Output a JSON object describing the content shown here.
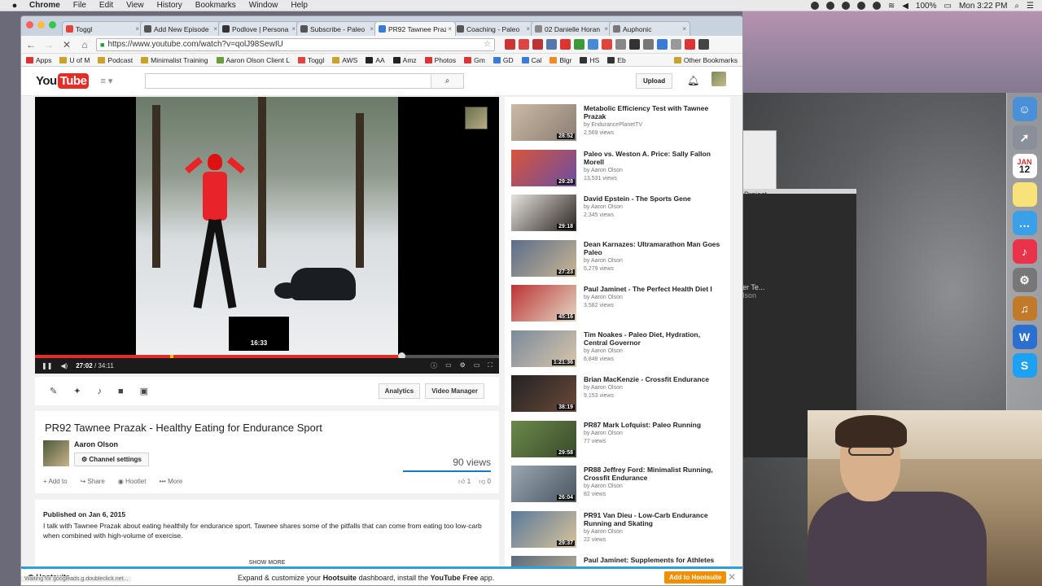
{
  "menubar": {
    "app": "Chrome",
    "items": [
      "File",
      "Edit",
      "View",
      "History",
      "Bookmarks",
      "Window",
      "Help"
    ],
    "battery": "100%",
    "clock": "Mon 3:22 PM"
  },
  "browser": {
    "tabs": [
      {
        "label": "Toggl",
        "color": "#e0443c"
      },
      {
        "label": "Add New Episode",
        "color": "#555"
      },
      {
        "label": "Podlove | Persona",
        "color": "#333"
      },
      {
        "label": "Subscribe - Paleo",
        "color": "#555"
      },
      {
        "label": "PR92 Tawnee Praz",
        "color": "#3a7bd5"
      },
      {
        "label": "Coaching - Paleo",
        "color": "#555"
      },
      {
        "label": "02 Danielle Horan",
        "color": "#888"
      },
      {
        "label": "Auphonic",
        "color": "#777"
      }
    ],
    "url": "https://www.youtube.com/watch?v=qolJ98SewIU",
    "bookmarks": [
      {
        "label": "Apps",
        "color": "#d33"
      },
      {
        "label": "U of M",
        "color": "#c9a227"
      },
      {
        "label": "Podcast",
        "color": "#c9a227"
      },
      {
        "label": "Minimalist Training",
        "color": "#c9a227"
      },
      {
        "label": "Aaron Olson Client L",
        "color": "#6a9e3a"
      },
      {
        "label": "Toggl",
        "color": "#e0443c"
      },
      {
        "label": "AWS",
        "color": "#c9a227"
      },
      {
        "label": "AA",
        "color": "#222"
      },
      {
        "label": "Amz",
        "color": "#222"
      },
      {
        "label": "Photos",
        "color": "#d33"
      },
      {
        "label": "Gm",
        "color": "#d33"
      },
      {
        "label": "GD",
        "color": "#3a7bd5"
      },
      {
        "label": "Cal",
        "color": "#3a7bd5"
      },
      {
        "label": "Blgr",
        "color": "#f08a24"
      },
      {
        "label": "HS",
        "color": "#333"
      },
      {
        "label": "Eb",
        "color": "#333"
      },
      {
        "label": "Other Bookmarks",
        "color": "#c9a227"
      }
    ]
  },
  "youtube": {
    "logo_you": "You",
    "logo_tube": "Tube",
    "upload": "Upload",
    "player": {
      "current_time": "27:02",
      "duration": "/ 34:11",
      "hover_time": "16:33",
      "played_fraction": 0.79
    },
    "edit_buttons": [
      "Analytics",
      "Video Manager"
    ],
    "video": {
      "title": "PR92 Tawnee Prazak - Healthy Eating for Endurance Sport",
      "owner": "Aaron Olson",
      "channel_settings": "Channel settings",
      "views": "90 views",
      "actions": [
        "Add to",
        "Share",
        "Hootlet",
        "More"
      ],
      "likes": "1",
      "dislikes": "0",
      "published": "Published on Jan 6, 2015",
      "description": "I talk with Tawnee Prazak about eating healthily for endurance sport. Tawnee shares some of the pitfalls that can come from eating too low-carb when combined with high-volume of exercise.",
      "show_more": "SHOW MORE"
    },
    "related": [
      {
        "title": "Metabolic Efficiency Test with Tawnee Prazak",
        "by": "by EndurancePlanetTV",
        "views": "2,569 views",
        "duration": "28:52",
        "c1": "#cbb9a4",
        "c2": "#8a7e74"
      },
      {
        "title": "Paleo vs. Weston A. Price: Sally Fallon Morell",
        "by": "by Aaron Olson",
        "views": "13,531 views",
        "duration": "29:28",
        "c1": "#d9553a",
        "c2": "#6a4ea2"
      },
      {
        "title": "David Epstein - The Sports Gene",
        "by": "by Aaron Olson",
        "views": "2,345 views",
        "duration": "29:18",
        "c1": "#e6e2dc",
        "c2": "#2a2420"
      },
      {
        "title": "Dean Karnazes: Ultramarathon Man Goes Paleo",
        "by": "by Aaron Olson",
        "views": "5,279 views",
        "duration": "27:23",
        "c1": "#5a6e8a",
        "c2": "#c9b593"
      },
      {
        "title": "Paul Jaminet - The Perfect Health Diet I",
        "by": "by Aaron Olson",
        "views": "3,582 views",
        "duration": "45:16",
        "c1": "#b33",
        "c2": "#e3d7c5"
      },
      {
        "title": "Tim Noakes - Paleo Diet, Hydration, Central Governor",
        "by": "by Aaron Olson",
        "views": "6,848 views",
        "duration": "1:21:36",
        "c1": "#7a8a9c",
        "c2": "#d9c6aa"
      },
      {
        "title": "Brian MacKenzie - Crossfit Endurance",
        "by": "by Aaron Olson",
        "views": "9,153 views",
        "duration": "38:19",
        "c1": "#222",
        "c2": "#6a4a3a"
      },
      {
        "title": "PR87 Mark Lofquist: Paleo Running",
        "by": "by Aaron Olson",
        "views": "77 views",
        "duration": "29:58",
        "c1": "#6a8a4a",
        "c2": "#3a4a2a"
      },
      {
        "title": "PR88 Jeffrey Ford: Minimalist Running, Crossfit Endurance",
        "by": "by Aaron Olson",
        "views": "82 views",
        "duration": "26:04",
        "c1": "#9aa6b2",
        "c2": "#4a5562"
      },
      {
        "title": "PR91 Van Dieu - Low-Carb Endurance Running and Skating",
        "by": "by Aaron Olson",
        "views": "22 views",
        "duration": "29:37",
        "c1": "#5a7a9a",
        "c2": "#d9c29a"
      },
      {
        "title": "Paul Jaminet: Supplements for Athletes",
        "by": "",
        "views": "",
        "duration": "",
        "c1": "#5a6a7a",
        "c2": "#c9b99a"
      }
    ]
  },
  "hootsuite": {
    "logo": "Hootsuite",
    "msg_pre": "Expand & customize your ",
    "msg_b1": "Hootsuite",
    "msg_mid": " dashboard, install the ",
    "msg_b2": "YouTube Free",
    "msg_post": " app.",
    "button": "Add to Hootsuite",
    "status": "Waiting for googleads.g.doubleclick.net..."
  },
  "desktop": {
    "bg_window_text": "Project",
    "bg_window_text2": "er Te...",
    "bg_window_text3": "Ison",
    "dock_date": "12",
    "dock_month": "JAN"
  }
}
